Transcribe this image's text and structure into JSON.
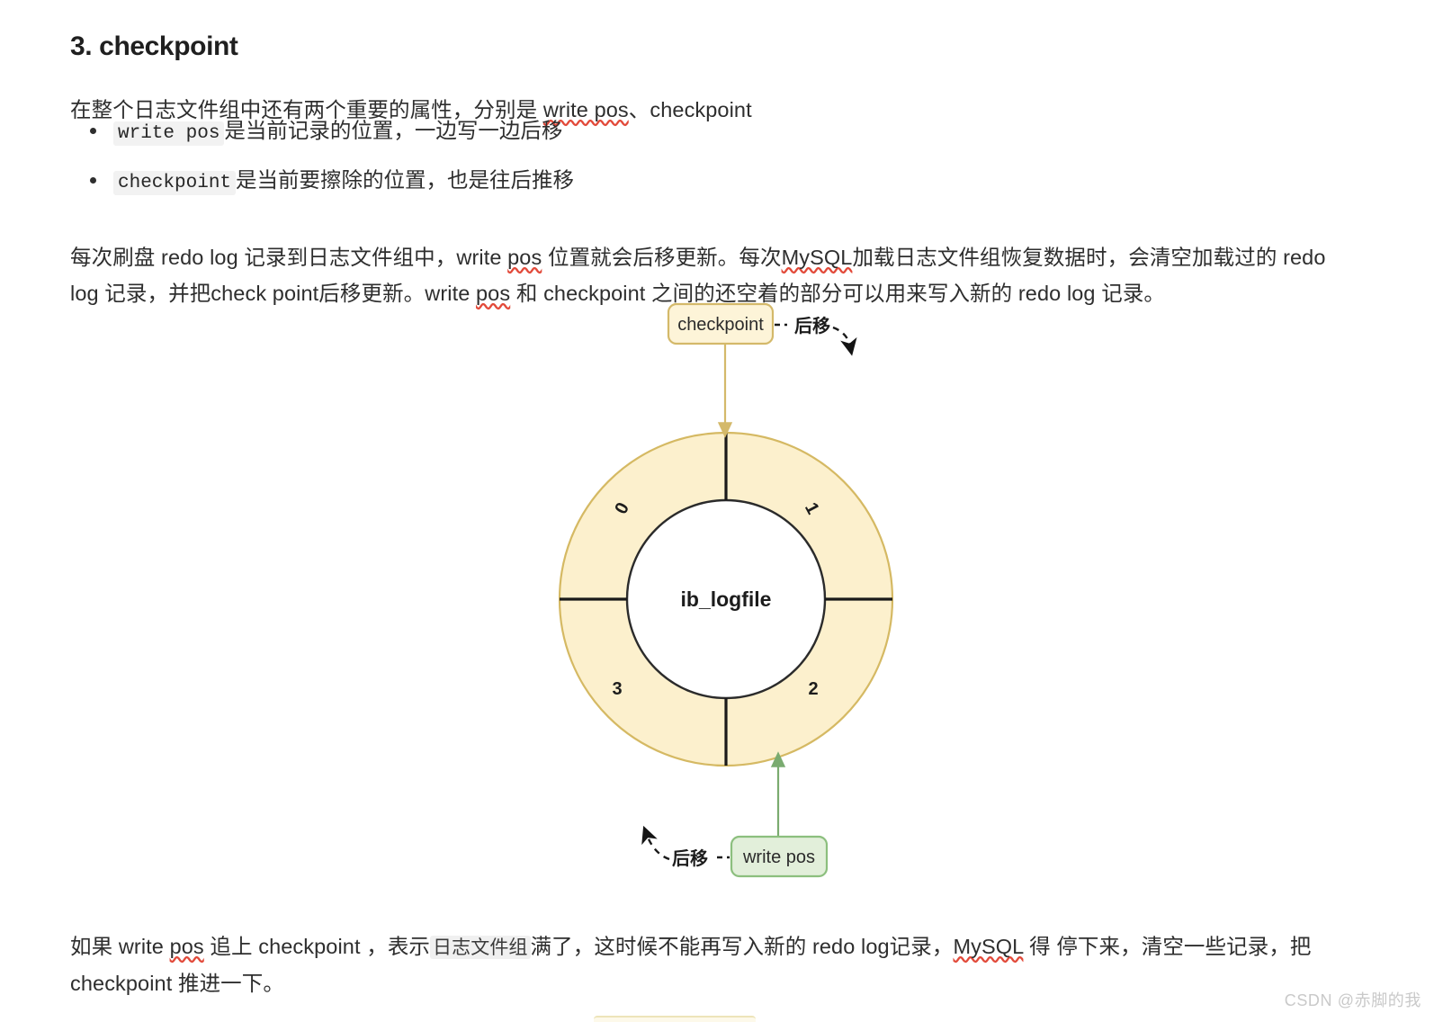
{
  "document": {
    "heading": "3. checkpoint",
    "paragraphs": {
      "intro_before": "在整个日志文件组中还有两个重要的属性，分别是 ",
      "intro_code1": "write pos",
      "intro_sep": "、",
      "intro_code2": "checkpoint",
      "body_1": "每次刷盘 redo log 记录到日志文件组中，write ",
      "body_2": "pos",
      "body_3": " 位置就会后移更新。每次",
      "body_4": "MySQL",
      "body_5": "加载日志文件组恢复数据时，会清空加载过的 redo log 记录，并把check point后移更新。write ",
      "body_6": "pos",
      "body_7": " 和 checkpoint 之间的还空着的部分可以用来写入新的 redo log 记录。",
      "tail_1": "如果 write ",
      "tail_2": "pos",
      "tail_3": " 追上 checkpoint ，表示",
      "tail_code": "日志文件组",
      "tail_4": "满了，这时候不能再写入新的 redo log记录，",
      "tail_5": "MySQL",
      "tail_6": " 得 停下来，清空一些记录，把 checkpoint 推进一下。"
    },
    "bullets": [
      {
        "code": "write pos",
        "text": "是当前记录的位置，一边写一边后移"
      },
      {
        "code": "checkpoint",
        "text": "是当前要擦除的位置，也是往后推移"
      }
    ],
    "watermark": "CSDN @赤脚的我"
  },
  "diagram": {
    "center_label": "ib_logfile",
    "checkpoint_box": {
      "label": "checkpoint",
      "fill": "#fdf4d8",
      "stroke": "#d4b96a"
    },
    "writepos_box": {
      "label": "write pos",
      "fill": "#e2efda",
      "stroke": "#8cbf7e"
    },
    "checkpoint_move_label": "后移",
    "writepos_move_label": "后移",
    "segments": [
      {
        "label": "0",
        "rotation": -62
      },
      {
        "label": "1",
        "rotation": 62
      },
      {
        "label": "2",
        "rotation": 0
      },
      {
        "label": "3",
        "rotation": 0
      }
    ],
    "colors": {
      "ring_fill": "#fcf0cd",
      "ring_stroke": "#d5b963",
      "divider": "#1a1a1a",
      "inner_fill": "#ffffff",
      "inner_stroke": "#2b2b2b",
      "checkpoint_arrow": "#d4b96a",
      "writepos_arrow": "#7aab70",
      "dashed_arrow": "#1a1a1a"
    }
  }
}
